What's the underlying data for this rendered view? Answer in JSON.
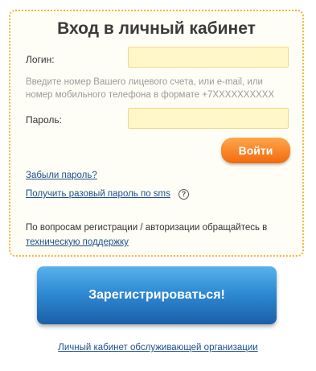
{
  "form": {
    "title": "Вход в личный кабинет",
    "login_label": "Логин:",
    "login_value": "",
    "login_hint": "Введите номер Вашего лицевого счета, или e-mail, или номер мобильного телефона в формате +7XXXXXXXXXX",
    "password_label": "Пароль:",
    "password_value": "",
    "submit_label": "Войти",
    "forgot_link": "Забыли пароль?",
    "sms_link": "Получить разовый пароль по sms",
    "help_glyph": "?",
    "support_text": "По вопросам регистрации / авторизации обращайтесь в",
    "support_link": "техническую поддержку"
  },
  "register": {
    "label": "Зарегистрироваться!"
  },
  "footer": {
    "org_link": "Личный кабинет обслуживающей организации"
  },
  "colors": {
    "panel_border": "#f0b63a",
    "input_bg": "#fff7c8",
    "login_button": "#f26a0e",
    "register_button": "#2f8bd3",
    "link": "#1d4f8c"
  },
  "icons": {
    "help": "help-circle-icon"
  }
}
